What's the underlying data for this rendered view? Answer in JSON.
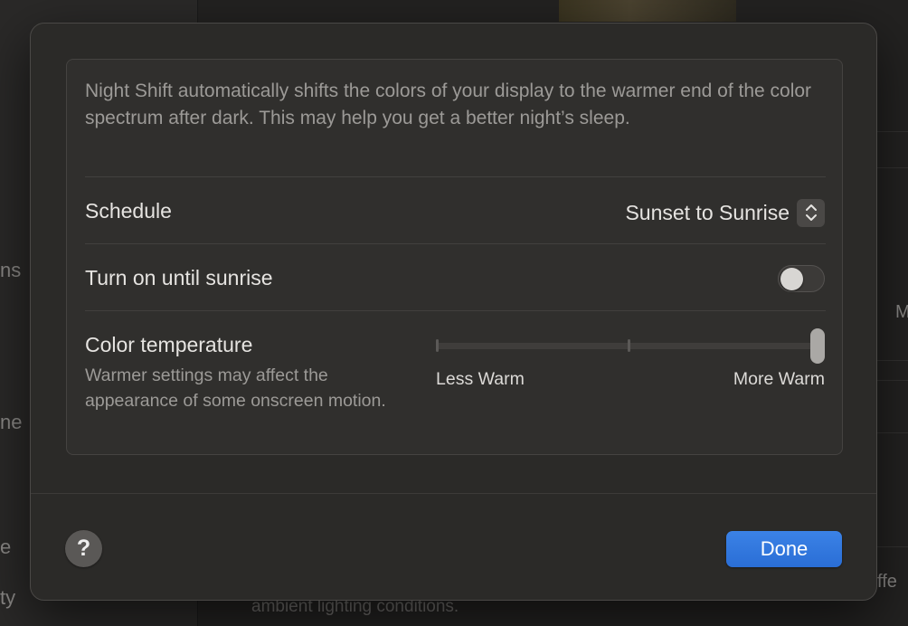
{
  "background": {
    "sidebar_fragments": [
      "ns",
      "ne",
      "e",
      "ty"
    ],
    "right_fragments": [
      "M",
      "ffe"
    ],
    "bottom_text": "ambient lighting conditions."
  },
  "night_shift": {
    "description": "Night Shift automatically shifts the colors of your display to the warmer end of the color spectrum after dark. This may help you get a better night’s sleep.",
    "schedule": {
      "label": "Schedule",
      "value": "Sunset to Sunrise"
    },
    "turn_on_until_sunrise": {
      "label": "Turn on until sunrise",
      "enabled": false
    },
    "color_temperature": {
      "label": "Color temperature",
      "subtitle": "Warmer settings may affect the appearance of some onscreen motion.",
      "min_label": "Less Warm",
      "max_label": "More Warm",
      "value": 1.0
    }
  },
  "footer": {
    "help_label": "?",
    "done_label": "Done"
  },
  "colors": {
    "accent": "#2f76e0",
    "sheet_background": "#2b2a28"
  },
  "icons": {
    "popup": "chevron-up-down-icon",
    "help": "question-mark-icon"
  }
}
